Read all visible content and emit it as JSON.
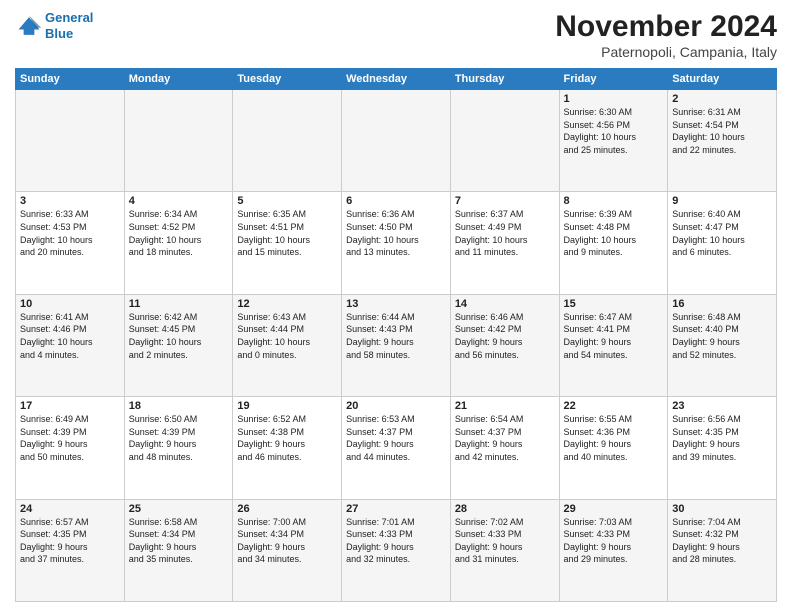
{
  "header": {
    "logo_line1": "General",
    "logo_line2": "Blue",
    "month": "November 2024",
    "location": "Paternopoli, Campania, Italy"
  },
  "weekdays": [
    "Sunday",
    "Monday",
    "Tuesday",
    "Wednesday",
    "Thursday",
    "Friday",
    "Saturday"
  ],
  "weeks": [
    [
      {
        "day": "",
        "info": ""
      },
      {
        "day": "",
        "info": ""
      },
      {
        "day": "",
        "info": ""
      },
      {
        "day": "",
        "info": ""
      },
      {
        "day": "",
        "info": ""
      },
      {
        "day": "1",
        "info": "Sunrise: 6:30 AM\nSunset: 4:56 PM\nDaylight: 10 hours\nand 25 minutes."
      },
      {
        "day": "2",
        "info": "Sunrise: 6:31 AM\nSunset: 4:54 PM\nDaylight: 10 hours\nand 22 minutes."
      }
    ],
    [
      {
        "day": "3",
        "info": "Sunrise: 6:33 AM\nSunset: 4:53 PM\nDaylight: 10 hours\nand 20 minutes."
      },
      {
        "day": "4",
        "info": "Sunrise: 6:34 AM\nSunset: 4:52 PM\nDaylight: 10 hours\nand 18 minutes."
      },
      {
        "day": "5",
        "info": "Sunrise: 6:35 AM\nSunset: 4:51 PM\nDaylight: 10 hours\nand 15 minutes."
      },
      {
        "day": "6",
        "info": "Sunrise: 6:36 AM\nSunset: 4:50 PM\nDaylight: 10 hours\nand 13 minutes."
      },
      {
        "day": "7",
        "info": "Sunrise: 6:37 AM\nSunset: 4:49 PM\nDaylight: 10 hours\nand 11 minutes."
      },
      {
        "day": "8",
        "info": "Sunrise: 6:39 AM\nSunset: 4:48 PM\nDaylight: 10 hours\nand 9 minutes."
      },
      {
        "day": "9",
        "info": "Sunrise: 6:40 AM\nSunset: 4:47 PM\nDaylight: 10 hours\nand 6 minutes."
      }
    ],
    [
      {
        "day": "10",
        "info": "Sunrise: 6:41 AM\nSunset: 4:46 PM\nDaylight: 10 hours\nand 4 minutes."
      },
      {
        "day": "11",
        "info": "Sunrise: 6:42 AM\nSunset: 4:45 PM\nDaylight: 10 hours\nand 2 minutes."
      },
      {
        "day": "12",
        "info": "Sunrise: 6:43 AM\nSunset: 4:44 PM\nDaylight: 10 hours\nand 0 minutes."
      },
      {
        "day": "13",
        "info": "Sunrise: 6:44 AM\nSunset: 4:43 PM\nDaylight: 9 hours\nand 58 minutes."
      },
      {
        "day": "14",
        "info": "Sunrise: 6:46 AM\nSunset: 4:42 PM\nDaylight: 9 hours\nand 56 minutes."
      },
      {
        "day": "15",
        "info": "Sunrise: 6:47 AM\nSunset: 4:41 PM\nDaylight: 9 hours\nand 54 minutes."
      },
      {
        "day": "16",
        "info": "Sunrise: 6:48 AM\nSunset: 4:40 PM\nDaylight: 9 hours\nand 52 minutes."
      }
    ],
    [
      {
        "day": "17",
        "info": "Sunrise: 6:49 AM\nSunset: 4:39 PM\nDaylight: 9 hours\nand 50 minutes."
      },
      {
        "day": "18",
        "info": "Sunrise: 6:50 AM\nSunset: 4:39 PM\nDaylight: 9 hours\nand 48 minutes."
      },
      {
        "day": "19",
        "info": "Sunrise: 6:52 AM\nSunset: 4:38 PM\nDaylight: 9 hours\nand 46 minutes."
      },
      {
        "day": "20",
        "info": "Sunrise: 6:53 AM\nSunset: 4:37 PM\nDaylight: 9 hours\nand 44 minutes."
      },
      {
        "day": "21",
        "info": "Sunrise: 6:54 AM\nSunset: 4:37 PM\nDaylight: 9 hours\nand 42 minutes."
      },
      {
        "day": "22",
        "info": "Sunrise: 6:55 AM\nSunset: 4:36 PM\nDaylight: 9 hours\nand 40 minutes."
      },
      {
        "day": "23",
        "info": "Sunrise: 6:56 AM\nSunset: 4:35 PM\nDaylight: 9 hours\nand 39 minutes."
      }
    ],
    [
      {
        "day": "24",
        "info": "Sunrise: 6:57 AM\nSunset: 4:35 PM\nDaylight: 9 hours\nand 37 minutes."
      },
      {
        "day": "25",
        "info": "Sunrise: 6:58 AM\nSunset: 4:34 PM\nDaylight: 9 hours\nand 35 minutes."
      },
      {
        "day": "26",
        "info": "Sunrise: 7:00 AM\nSunset: 4:34 PM\nDaylight: 9 hours\nand 34 minutes."
      },
      {
        "day": "27",
        "info": "Sunrise: 7:01 AM\nSunset: 4:33 PM\nDaylight: 9 hours\nand 32 minutes."
      },
      {
        "day": "28",
        "info": "Sunrise: 7:02 AM\nSunset: 4:33 PM\nDaylight: 9 hours\nand 31 minutes."
      },
      {
        "day": "29",
        "info": "Sunrise: 7:03 AM\nSunset: 4:33 PM\nDaylight: 9 hours\nand 29 minutes."
      },
      {
        "day": "30",
        "info": "Sunrise: 7:04 AM\nSunset: 4:32 PM\nDaylight: 9 hours\nand 28 minutes."
      }
    ]
  ]
}
